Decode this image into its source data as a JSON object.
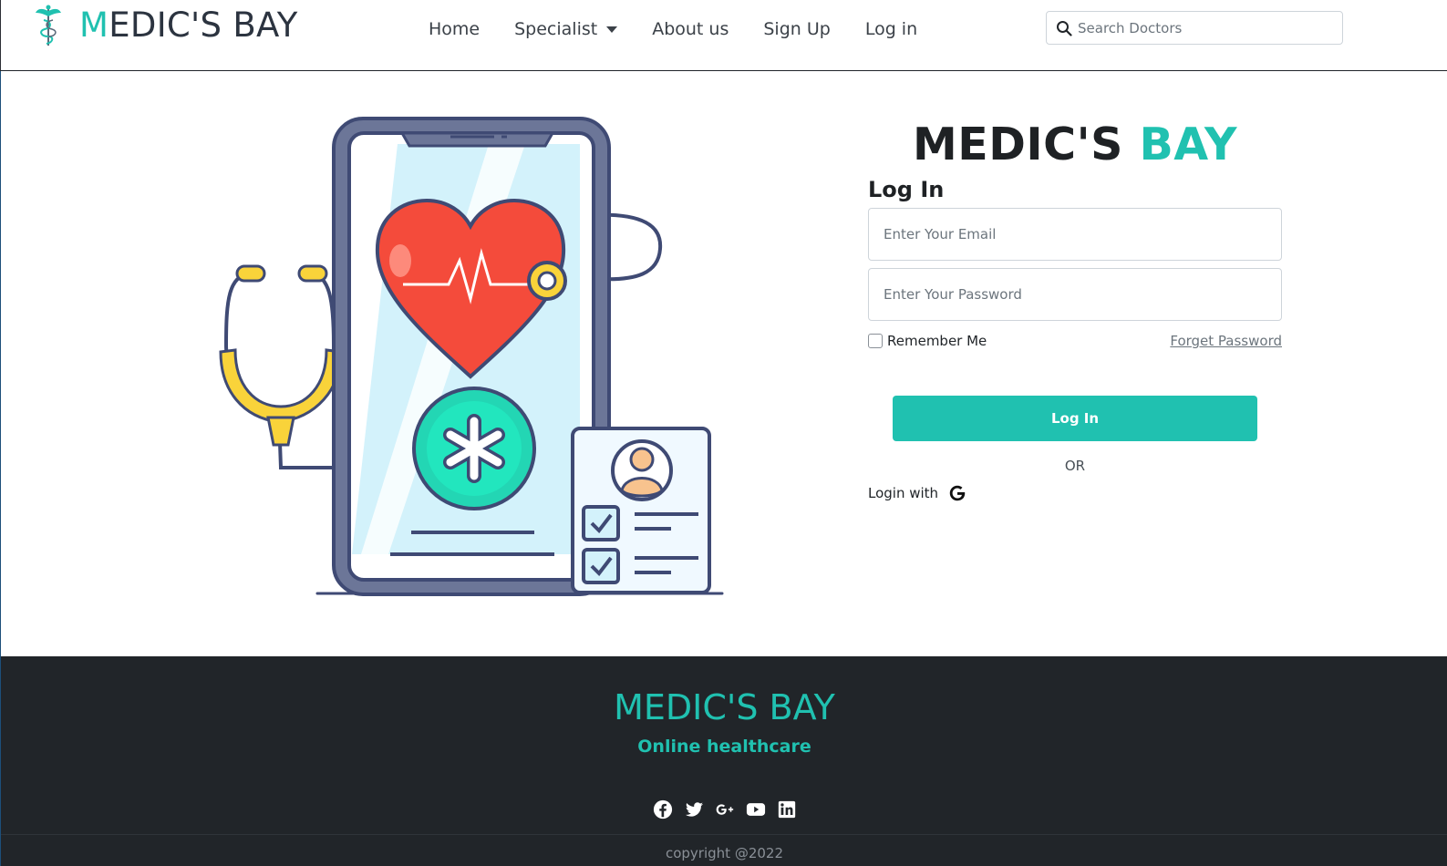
{
  "navbar": {
    "brand_first": "M",
    "brand_rest": "EDIC'S BAY",
    "links": {
      "home": "Home",
      "specialist": "Specialist",
      "about": "About us",
      "signup": "Sign Up",
      "login": "Log in"
    },
    "search_placeholder": "Search Doctors",
    "icons": [
      "caduceus-logo",
      "caret-down-icon",
      "search-icon"
    ]
  },
  "login": {
    "title_first": "MEDIC'S",
    "title_second": "BAY",
    "heading": "Log In",
    "email_placeholder": "Enter Your Email",
    "password_placeholder": "Enter Your Password",
    "remember_label": "Remember Me",
    "forget_label": "Forget Password",
    "button_label": "Log In",
    "or_label": "OR",
    "login_with_label": "Login with",
    "icons": [
      "google-icon"
    ]
  },
  "illustration": {
    "icons": [
      "phone-illustration",
      "heart-icon",
      "stethoscope-icon",
      "medical-star-icon",
      "patient-card-icon"
    ]
  },
  "footer": {
    "title": "MEDIC'S BAY",
    "subtitle": "Online healthcare",
    "social_icons": [
      "facebook-icon",
      "twitter-icon",
      "google-plus-icon",
      "youtube-icon",
      "linkedin-icon"
    ],
    "copyright": "copyright @2022"
  },
  "colors": {
    "accent": "#20c1b0",
    "dark": "#212529",
    "heart": "#f44b3b",
    "phone_frame": "#3f4a74",
    "stethoscope": "#f9d33a"
  }
}
